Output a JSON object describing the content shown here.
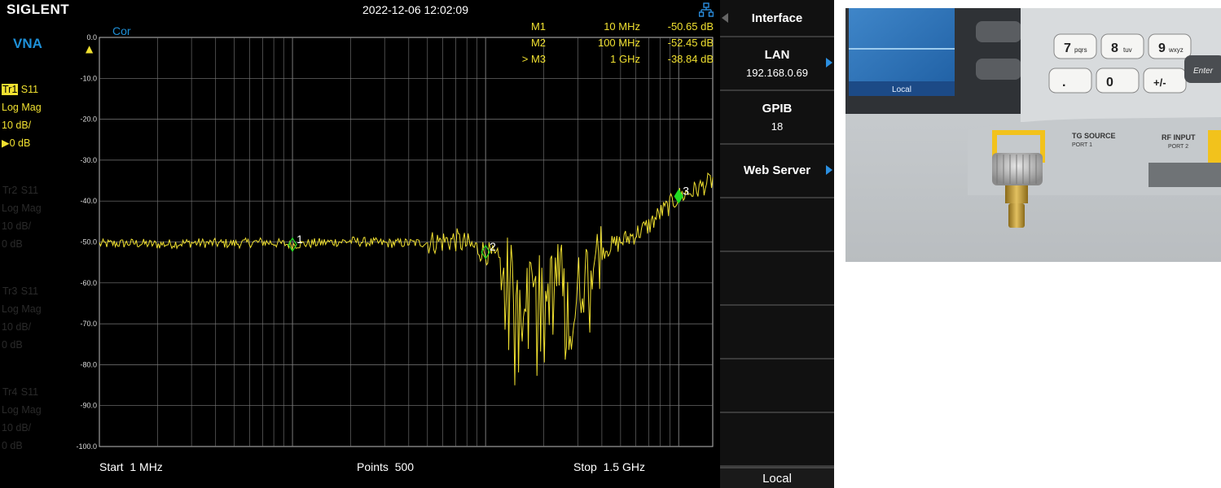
{
  "header": {
    "brand": "SIGLENT",
    "datetime": "2022-12-06 12:02:09"
  },
  "sidebar": {
    "mode": "VNA",
    "traces": [
      {
        "id": "Tr1",
        "param": "S11",
        "format": "Log Mag",
        "scale": "10 dB/",
        "ref": "0 dB",
        "active": true
      },
      {
        "id": "Tr2",
        "param": "S11",
        "format": "Log Mag",
        "scale": "10 dB/",
        "ref": "0 dB",
        "active": false
      },
      {
        "id": "Tr3",
        "param": "S11",
        "format": "Log Mag",
        "scale": "10 dB/",
        "ref": "0 dB",
        "active": false
      },
      {
        "id": "Tr4",
        "param": "S11",
        "format": "Log Mag",
        "scale": "10 dB/",
        "ref": "0 dB",
        "active": false
      }
    ]
  },
  "plot": {
    "correction": "Cor",
    "ref_marker": "▲",
    "start_label": "Start",
    "start_value": "1 MHz",
    "points_label": "Points",
    "points_value": "500",
    "stop_label": "Stop",
    "stop_value": "1.5 GHz"
  },
  "markers": [
    {
      "name": "M1",
      "freq": "10 MHz",
      "value": "-50.65 dB",
      "label": "1"
    },
    {
      "name": "M2",
      "freq": "100 MHz",
      "value": "-52.45 dB",
      "label": "2"
    },
    {
      "name": "> M3",
      "freq": "1 GHz",
      "value": "-38.84 dB",
      "label": "3"
    }
  ],
  "menu": {
    "title": "Interface",
    "lan_label": "LAN",
    "lan_value": "192.168.0.69",
    "gpib_label": "GPIB",
    "gpib_value": "18",
    "web_label": "Web Server",
    "status": "Local"
  },
  "photo": {
    "keys": [
      "7",
      "8",
      "9",
      ".",
      "0",
      "+/-",
      "Enter"
    ],
    "key_subs": [
      "pqrs",
      "tuv",
      "wxyz",
      "",
      "",
      "",
      ""
    ],
    "screen_label": "Local",
    "port1_label": "TG SOURCE",
    "port1_sub": "PORT 1",
    "port2_label": "RF INPUT",
    "port2_sub": "PORT 2"
  },
  "colors": {
    "trace": "#f0e030",
    "marker": "#22dd22",
    "accent": "#2b8fe0",
    "grid": "#7a7a7a"
  },
  "chart_data": {
    "type": "line",
    "x_scale": "log",
    "x_unit": "Hz",
    "xlim": [
      1000000,
      1500000000
    ],
    "ylim": [
      -100,
      0
    ],
    "y_ticks": [
      "0.0",
      "-10.0",
      "-20.0",
      "-30.0",
      "-40.0",
      "-50.0",
      "-60.0",
      "-70.0",
      "-80.0",
      "-90.0",
      "-100.0"
    ],
    "grid": true,
    "series": [
      {
        "x": [
          1000000,
          1500000,
          2000000,
          3000000,
          5000000,
          7000000,
          10000000,
          15000000,
          20000000,
          30000000,
          50000000,
          70000000,
          100000000,
          120000000,
          150000000,
          180000000,
          200000000,
          220000000,
          250000000,
          280000000,
          300000000,
          350000000,
          400000000,
          500000000,
          600000000,
          700000000,
          800000000,
          900000000,
          1000000000,
          1200000000,
          1500000000
        ],
        "y": [
          -50.5,
          -50.3,
          -50.6,
          -50.2,
          -50.4,
          -50.0,
          -50.65,
          -50.1,
          -49.8,
          -50.3,
          -50.2,
          -49.5,
          -52.45,
          -55,
          -63,
          -56,
          -66,
          -60,
          -58,
          -72,
          -62,
          -55,
          -52,
          -50,
          -48,
          -46,
          -43,
          -41,
          -38.84,
          -37.5,
          -35
        ]
      }
    ],
    "markers": [
      {
        "label": "1",
        "x": 10000000,
        "y": -50.65
      },
      {
        "label": "2",
        "x": 100000000,
        "y": -52.45
      },
      {
        "label": "3",
        "x": 1000000000,
        "y": -38.84
      }
    ]
  }
}
